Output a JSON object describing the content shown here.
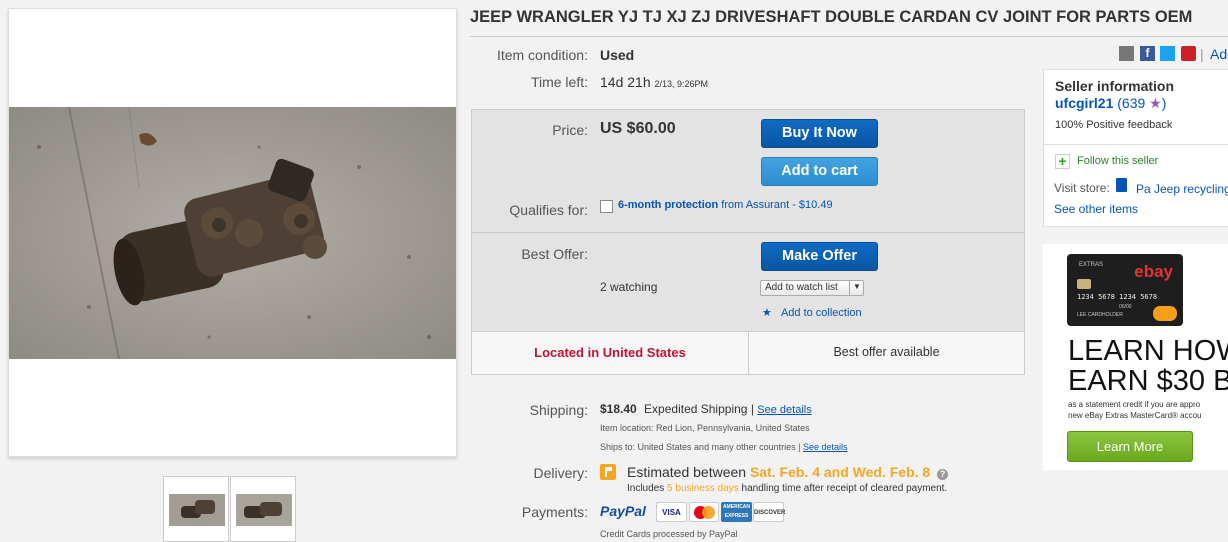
{
  "title": "JEEP WRANGLER YJ TJ XJ ZJ DRIVESHAFT DOUBLE CARDAN CV JOINT FOR PARTS OEM",
  "condition": {
    "label": "Item condition:",
    "value": "Used"
  },
  "time_left": {
    "label": "Time left:",
    "value": "14d 21h",
    "date": "2/13, 9:26PM"
  },
  "price": {
    "label": "Price:",
    "value": "US $60.00"
  },
  "buttons": {
    "buy_now": "Buy It Now",
    "add_to_cart": "Add to cart",
    "make_offer": "Make Offer",
    "add_watch": "Add to watch list",
    "add_collection": "Add to collection"
  },
  "qualifies": {
    "label": "Qualifies for:",
    "link": "6-month protection",
    "rest": "from Assurant - $10.49"
  },
  "best_offer": {
    "label": "Best Offer:",
    "watching": "2 watching"
  },
  "location_bar": {
    "located": "Located in United States",
    "offer": "Best offer available"
  },
  "shipping": {
    "label": "Shipping:",
    "cost": "$18.40",
    "method": "Expedited Shipping",
    "sep": "|",
    "see_details": "See details",
    "item_location": "Item location:  Red Lion, Pennsylvania, United States",
    "ships_to": "Ships to:  United States and many other countries",
    "ships_sep": "|",
    "see_details2": "See details"
  },
  "delivery": {
    "label": "Delivery:",
    "prefix": "Estimated between ",
    "dates": "Sat. Feb. 4 and Wed. Feb. 8",
    "includes": "Includes ",
    "days": "5 business days",
    "handling": " handling time after receipt of cleared payment.",
    "help": "?"
  },
  "payments": {
    "label": "Payments:",
    "paypal": "PayPal",
    "note": "Credit Cards processed by PayPal",
    "cards": [
      "VISA",
      "MasterCard",
      "AMERICAN EXPRESS",
      "DISCOVER"
    ]
  },
  "share": {
    "sep": "|",
    "add": "Add"
  },
  "seller": {
    "heading": "Seller information",
    "name": "ufcgirl21",
    "score": "(639",
    "star": "★",
    "score_end": ")",
    "feedback": "100% Positive feedback",
    "follow": "Follow this seller",
    "visit_label": "Visit store:",
    "store": "Pa Jeep recycling",
    "other": "See other items"
  },
  "ad": {
    "card_label": "EXTRAS",
    "card_logo": "ebay",
    "card_number": "1234 5678 1234 5678",
    "card_exp": "00/00",
    "card_holder": "LEE CARDHOLDER",
    "heading1": "LEARN HOW",
    "heading2": "EARN $30 B",
    "fine1": "as a statement credit if you are appro",
    "fine2": "new eBay Extras MasterCard® accou",
    "button": "Learn More"
  },
  "colors": {
    "link": "#0654ba",
    "located": "#c4122f",
    "orange": "#f5a623",
    "green_btn": "#6aa81e"
  }
}
